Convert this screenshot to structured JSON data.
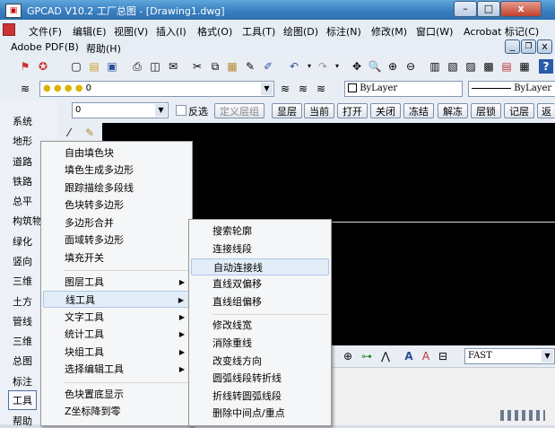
{
  "window": {
    "title": "GPCAD V10.2 工厂总图 - [Drawing1.dwg]",
    "min": "–",
    "max": "□",
    "close": "x"
  },
  "menu": {
    "items": [
      "文件(F)",
      "编辑(E)",
      "视图(V)",
      "插入(I)",
      "格式(O)",
      "工具(T)",
      "绘图(D)",
      "标注(N)",
      "修改(M)",
      "窗口(W)",
      "Acrobat 标记(C)",
      "Adobe PDF(B)",
      "帮助(H)"
    ],
    "inner_min": "_",
    "inner_restore": "❐",
    "inner_close": "x"
  },
  "layer_toolbar": {
    "layer_value": "0",
    "color_value": "ByLayer",
    "linetype_value": "ByLayer"
  },
  "layer_toolbar2": {
    "layer_combo": "0",
    "reverse_label": "反选",
    "buttons": [
      "定义层组",
      "显层",
      "当前",
      "打开",
      "关闭",
      "冻结",
      "解冻",
      "层锁",
      "记层",
      "返"
    ]
  },
  "sidebar": {
    "items": [
      "系统",
      "地形",
      "道路",
      "铁路",
      "总平",
      "构筑物",
      "绿化",
      "竖向",
      "三维",
      "土方",
      "管线",
      "三维",
      "总图",
      "标注",
      "工具",
      "帮助"
    ]
  },
  "menu1": {
    "items": [
      "自由填色块",
      "填色生成多边形",
      "跟踪描绘多段线",
      "色块转多边形",
      "多边形合并",
      "面域转多边形",
      "填充开关",
      "图层工具",
      "线工具",
      "文字工具",
      "统计工具",
      "块组工具",
      "选择编辑工具",
      "色块置底显示",
      "Z坐标降到零"
    ]
  },
  "menu2": {
    "items": [
      "搜索轮廓",
      "连接线段",
      "自动连接线",
      "直线双偏移",
      "直线组偏移",
      "修改线宽",
      "消除重线",
      "改变线方向",
      "圆弧线段转折线",
      "折线转圆弧线段",
      "删除中间点/重点"
    ]
  },
  "bottom_toolbar": {
    "combo": "FAST"
  }
}
